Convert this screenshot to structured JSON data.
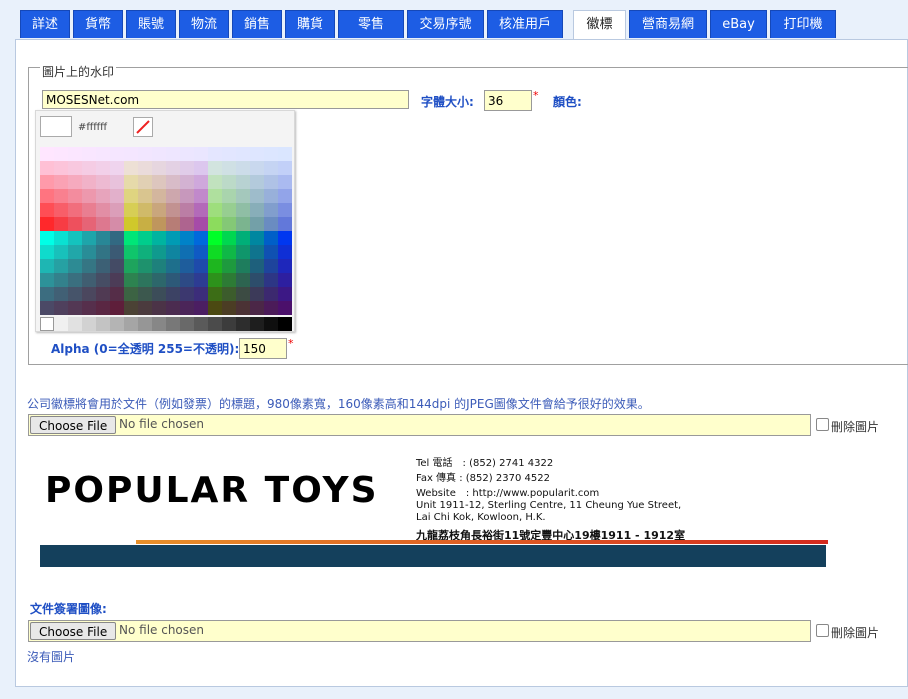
{
  "tabs": [
    {
      "label": "詳述"
    },
    {
      "label": "貨幣"
    },
    {
      "label": "賬號"
    },
    {
      "label": "物流"
    },
    {
      "label": "銷售"
    },
    {
      "label": "購貨"
    },
    {
      "label": "零售"
    },
    {
      "label": "交易序號"
    },
    {
      "label": "核准用戶"
    },
    {
      "label": "徽標"
    },
    {
      "label": "營商易網"
    },
    {
      "label": "eBay"
    },
    {
      "label": "打印機"
    }
  ],
  "active_tab": "徽標",
  "watermark": {
    "legend": "圖片上的水印",
    "text_value": "MOSESNet.com",
    "font_size_label": "字體大小:",
    "font_size_value": "36",
    "required_mark": "*",
    "color_label": "顏色:",
    "color_value": "#ffffff",
    "alpha_label": "Alpha (0=全透明 255=不透明):",
    "alpha_value": "150"
  },
  "logo_section": {
    "note": "公司徽標將會用於文件（例如發票）的標題，980像素寬，160像素高和144dpi 的JPEG圖像文件會給予很好的效果。",
    "choose_file": "Choose File",
    "no_file": "No file chosen",
    "delete_label": "刪除圖片",
    "logo": {
      "company": "POPULAR TOYS",
      "tel": "Tel 電話　: (852) 2741 4322",
      "fax": "Fax 傳真 : (852) 2370 4522",
      "website": "Website　: http://www.popularit.com",
      "address1": "Unit 1911-12, Sterling Centre, 11 Cheung Yue Street,",
      "address2": "Lai Chi Kok, Kowloon, H.K.",
      "address_zh": "九龍荔枝角長裕街11號定豐中心19樓1911 - 1912室",
      "bar_colors": {
        "red": "#d42a1e",
        "orange": "#e8902a",
        "navy": "#14405c"
      }
    }
  },
  "signature_section": {
    "label": "文件簽署圖像:",
    "choose_file": "Choose File",
    "no_file": "No file chosen",
    "delete_label": "刪除圖片",
    "empty_text": "沒有圖片"
  },
  "colors": {
    "tab_blue": "#1d5de4",
    "label_blue": "#1f4fc4",
    "input_yellow": "#ffffcc"
  }
}
